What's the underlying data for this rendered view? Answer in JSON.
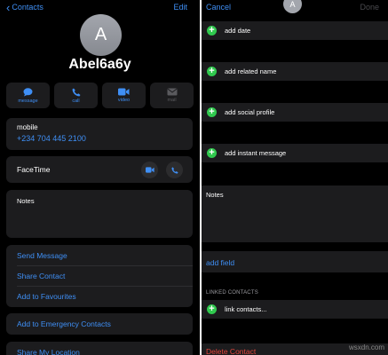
{
  "left": {
    "nav": {
      "back_label": "Contacts",
      "edit_label": "Edit"
    },
    "avatar_initial": "A",
    "contact_name": "Abel6a6y",
    "actions": [
      {
        "icon": "message-icon",
        "label": "message"
      },
      {
        "icon": "phone-icon",
        "label": "call"
      },
      {
        "icon": "video-icon",
        "label": "video"
      },
      {
        "icon": "mail-icon",
        "label": "mail"
      }
    ],
    "mobile": {
      "label": "mobile",
      "value": "+234 704 445 2100"
    },
    "facetime": {
      "label": "FaceTime"
    },
    "notes": {
      "label": "Notes"
    },
    "links": [
      "Send Message",
      "Share Contact",
      "Add to Favourites"
    ],
    "emergency": "Add to Emergency Contacts",
    "location": "Share My Location"
  },
  "right": {
    "nav": {
      "cancel_label": "Cancel",
      "done_label": "Done",
      "avatar_initial": "A"
    },
    "add_rows": [
      "add date",
      "add related name",
      "add social profile",
      "add instant message"
    ],
    "notes": {
      "label": "Notes"
    },
    "add_field": "add field",
    "linked_header": "LINKED CONTACTS",
    "link_contacts": "link contacts...",
    "delete_contact": "Delete Contact"
  },
  "watermark": "wsxdn.com",
  "colors": {
    "accent": "#3f8ff5",
    "destructive": "#e2453c",
    "add": "#30c94e",
    "background": "#000000",
    "cell": "#1c1c1e"
  }
}
